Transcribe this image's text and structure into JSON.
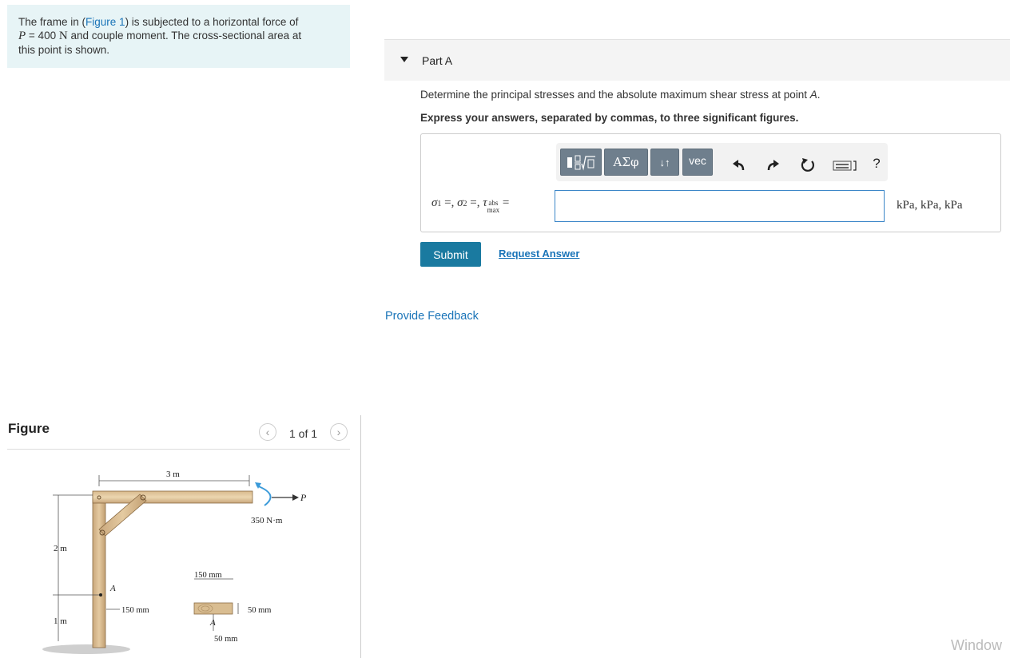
{
  "problem": {
    "line1_pre": "The frame in (",
    "figure_link": "Figure 1",
    "line1_post": ") is subjected to a horizontal force of",
    "force_symbol": "P",
    "force_value": " = 400 ",
    "force_unit": "N",
    "line2_post": " and couple moment. The cross-sectional area at",
    "line3": "this point is shown."
  },
  "figure_panel": {
    "heading": "Figure",
    "counter": "1 of 1",
    "prev_icon": "chevron-left-icon",
    "next_icon": "chevron-right-icon",
    "labels": {
      "span_top": "3 m",
      "force": "P",
      "moment": "350 N·m",
      "height_upper": "2 m",
      "height_lower": "1 m",
      "point": "A",
      "offset": "150 mm",
      "section_width": "150 mm",
      "section_height": "50 mm",
      "section_point": "A",
      "section_offset": "50 mm"
    }
  },
  "part": {
    "title": "Part A",
    "question_pre": "Determine the principal stresses and the absolute maximum shear stress at point ",
    "question_point": "A",
    "question_post": ".",
    "instruction": "Express your answers, separated by commas, to three significant figures."
  },
  "toolbar": {
    "templates_icon": "templates-icon",
    "greek": "ΑΣφ",
    "arrows": "↓↑",
    "vec": "vec",
    "undo_icon": "undo-icon",
    "redo_icon": "redo-icon",
    "reset_icon": "reset-icon",
    "keyboard_icon": "keyboard-icon",
    "help": "?"
  },
  "answer": {
    "sigma1": "σ",
    "sub1": "1",
    "sigma2": "σ",
    "sub2": "2",
    "tau": "τ",
    "tau_sub_top": "abs",
    "tau_sub_bottom": "max",
    "value": "",
    "units": "kPa, kPa, kPa"
  },
  "actions": {
    "submit": "Submit",
    "request_answer": "Request Answer",
    "feedback": "Provide Feedback"
  },
  "watermark": "Window"
}
